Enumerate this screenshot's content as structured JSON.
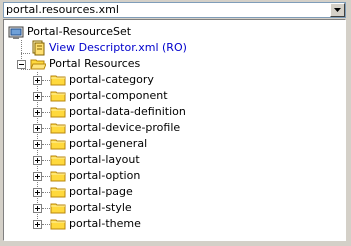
{
  "combo": {
    "value": "portal.resources.xml"
  },
  "tree": {
    "root": {
      "label": "Portal-ResourceSet"
    },
    "descriptor": {
      "label": "View Descriptor.xml (RO)"
    },
    "resources": {
      "label": "Portal Resources",
      "children": [
        {
          "label": "portal-category"
        },
        {
          "label": "portal-component"
        },
        {
          "label": "portal-data-definition"
        },
        {
          "label": "portal-device-profile"
        },
        {
          "label": "portal-general"
        },
        {
          "label": "portal-layout"
        },
        {
          "label": "portal-option"
        },
        {
          "label": "portal-page"
        },
        {
          "label": "portal-style"
        },
        {
          "label": "portal-theme"
        }
      ]
    }
  },
  "colors": {
    "folder": "#ffd93d",
    "folder_border": "#b8860b",
    "link": "#0000cc"
  }
}
